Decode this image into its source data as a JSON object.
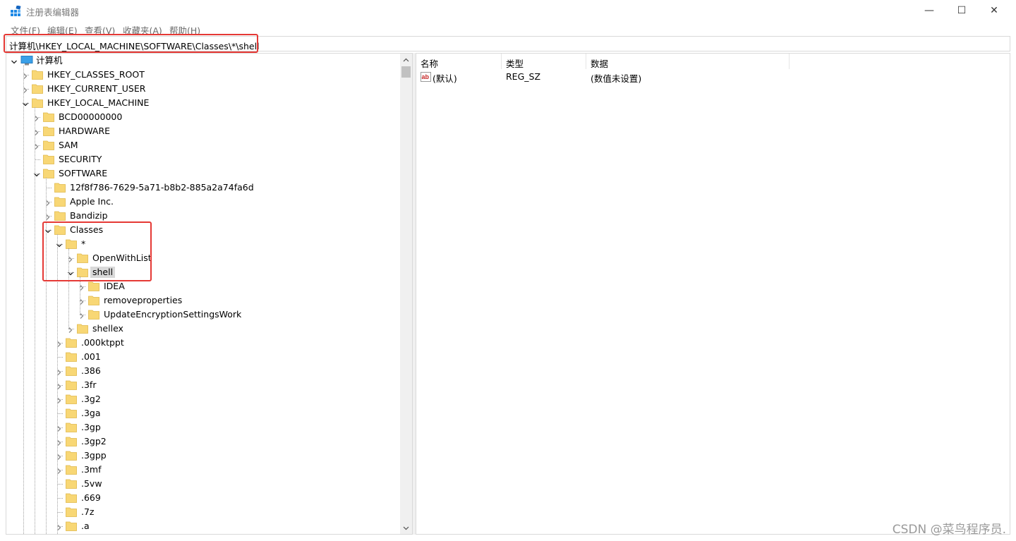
{
  "window": {
    "title": "注册表编辑器",
    "minimize_glyph": "—",
    "maximize_glyph": "☐",
    "close_glyph": "✕"
  },
  "menu": [
    "文件(F)",
    "编辑(E)",
    "查看(V)",
    "收藏夹(A)",
    "帮助(H)"
  ],
  "address": "计算机\\HKEY_LOCAL_MACHINE\\SOFTWARE\\Classes\\*\\shell",
  "tree": {
    "root": "计算机",
    "nodes": [
      {
        "label": "HKEY_CLASSES_ROOT",
        "depth": 1,
        "state": "collapsed"
      },
      {
        "label": "HKEY_CURRENT_USER",
        "depth": 1,
        "state": "collapsed"
      },
      {
        "label": "HKEY_LOCAL_MACHINE",
        "depth": 1,
        "state": "expanded"
      },
      {
        "label": "BCD00000000",
        "depth": 2,
        "state": "collapsed"
      },
      {
        "label": "HARDWARE",
        "depth": 2,
        "state": "collapsed"
      },
      {
        "label": "SAM",
        "depth": 2,
        "state": "collapsed"
      },
      {
        "label": "SECURITY",
        "depth": 2,
        "state": "leaf"
      },
      {
        "label": "SOFTWARE",
        "depth": 2,
        "state": "expanded"
      },
      {
        "label": "12f8f786-7629-5a71-b8b2-885a2a74fa6d",
        "depth": 3,
        "state": "leaf"
      },
      {
        "label": "Apple Inc.",
        "depth": 3,
        "state": "collapsed"
      },
      {
        "label": "Bandizip",
        "depth": 3,
        "state": "collapsed"
      },
      {
        "label": "Classes",
        "depth": 3,
        "state": "expanded"
      },
      {
        "label": "*",
        "depth": 4,
        "state": "expanded"
      },
      {
        "label": "OpenWithList",
        "depth": 5,
        "state": "collapsed"
      },
      {
        "label": "shell",
        "depth": 5,
        "state": "expanded",
        "selected": true
      },
      {
        "label": "IDEA",
        "depth": 6,
        "state": "collapsed"
      },
      {
        "label": "removeproperties",
        "depth": 6,
        "state": "collapsed"
      },
      {
        "label": "UpdateEncryptionSettingsWork",
        "depth": 6,
        "state": "collapsed"
      },
      {
        "label": "shellex",
        "depth": 5,
        "state": "collapsed"
      },
      {
        "label": ".000ktppt",
        "depth": 4,
        "state": "collapsed"
      },
      {
        "label": ".001",
        "depth": 4,
        "state": "leaf"
      },
      {
        "label": ".386",
        "depth": 4,
        "state": "collapsed"
      },
      {
        "label": ".3fr",
        "depth": 4,
        "state": "collapsed"
      },
      {
        "label": ".3g2",
        "depth": 4,
        "state": "collapsed"
      },
      {
        "label": ".3ga",
        "depth": 4,
        "state": "leaf"
      },
      {
        "label": ".3gp",
        "depth": 4,
        "state": "collapsed"
      },
      {
        "label": ".3gp2",
        "depth": 4,
        "state": "collapsed"
      },
      {
        "label": ".3gpp",
        "depth": 4,
        "state": "collapsed"
      },
      {
        "label": ".3mf",
        "depth": 4,
        "state": "collapsed"
      },
      {
        "label": ".5vw",
        "depth": 4,
        "state": "leaf"
      },
      {
        "label": ".669",
        "depth": 4,
        "state": "leaf"
      },
      {
        "label": ".7z",
        "depth": 4,
        "state": "leaf"
      },
      {
        "label": ".a",
        "depth": 4,
        "state": "collapsed"
      }
    ]
  },
  "list": {
    "columns": [
      "名称",
      "类型",
      "数据"
    ],
    "rows": [
      {
        "name": "(默认)",
        "type": "REG_SZ",
        "data": "(数值未设置)",
        "icon": "string-value-icon"
      }
    ]
  },
  "watermark": "CSDN @菜鸟程序员.",
  "colors": {
    "folder": "#f8d775",
    "folder_edge": "#e0b84a",
    "highlight_box": "#e53935",
    "selection": "#d9d9d9"
  }
}
